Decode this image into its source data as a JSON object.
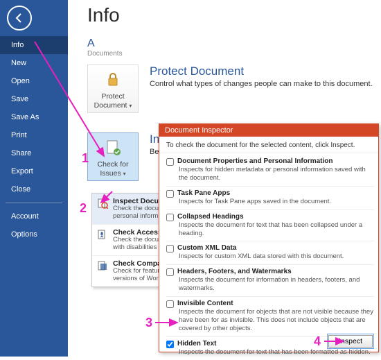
{
  "sidebar": {
    "items": [
      "Info",
      "New",
      "Open",
      "Save",
      "Save As",
      "Print",
      "Share",
      "Export",
      "Close"
    ],
    "acct": "Account",
    "opts": "Options"
  },
  "page": {
    "title": "Info",
    "sub": "A",
    "sublabel": "Documents"
  },
  "protect": {
    "btn": "Protect Document",
    "head": "Protect Document",
    "desc": "Control what types of changes people can make to this document."
  },
  "check": {
    "btn": "Check for Issues",
    "head": "Insp",
    "desc": "Before"
  },
  "menu": {
    "items": [
      {
        "t": "Inspect Document",
        "d": "Check the document or personal inform"
      },
      {
        "t": "Check Accessibilit",
        "d": "Check the document with disabilities mi"
      },
      {
        "t": "Check Compatibil",
        "d": "Check for features versions of Word."
      }
    ]
  },
  "dialog": {
    "title": "Document Inspector",
    "instr": "To check the document for the selected content, click Inspect.",
    "rows": [
      {
        "t": "Document Properties and Personal Information",
        "d": "Inspects for hidden metadata or personal information saved with the document.",
        "c": false
      },
      {
        "t": "Task Pane Apps",
        "d": "Inspects for Task Pane apps saved in the document.",
        "c": false
      },
      {
        "t": "Collapsed Headings",
        "d": "Inspects the document for text that has been collapsed under a heading.",
        "c": false
      },
      {
        "t": "Custom XML Data",
        "d": "Inspects for custom XML data stored with this document.",
        "c": false
      },
      {
        "t": "Headers, Footers, and Watermarks",
        "d": "Inspects the document for information in headers, footers, and watermarks.",
        "c": false
      },
      {
        "t": "Invisible Content",
        "d": "Inspects the document for objects that are not visible because they have been for as invisible. This does not include objects that are covered by other objects.",
        "c": false
      },
      {
        "t": "Hidden Text",
        "d": "Inspects the document for text that has been formatted as hidden.",
        "c": true
      }
    ],
    "btn": "Inspect"
  },
  "nums": [
    "1",
    "2",
    "3",
    "4"
  ]
}
